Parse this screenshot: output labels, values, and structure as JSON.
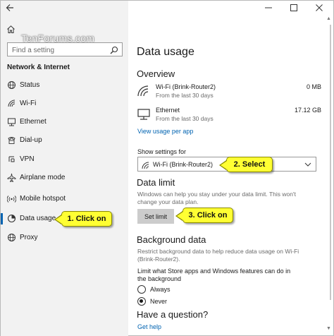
{
  "watermark": "TenForums.com",
  "sidebar": {
    "search_placeholder": "Find a setting",
    "heading": "Network & Internet",
    "items": [
      {
        "label": "Status",
        "icon": "globe-icon"
      },
      {
        "label": "Wi-Fi",
        "icon": "wifi-icon"
      },
      {
        "label": "Ethernet",
        "icon": "ethernet-icon"
      },
      {
        "label": "Dial-up",
        "icon": "dialup-icon"
      },
      {
        "label": "VPN",
        "icon": "vpn-icon"
      },
      {
        "label": "Airplane mode",
        "icon": "airplane-icon"
      },
      {
        "label": "Mobile hotspot",
        "icon": "hotspot-icon"
      },
      {
        "label": "Data usage",
        "icon": "data-usage-icon",
        "selected": true
      },
      {
        "label": "Proxy",
        "icon": "globe-icon"
      }
    ]
  },
  "main": {
    "title": "Data usage",
    "overview": {
      "heading": "Overview",
      "networks": [
        {
          "name": "Wi-Fi (Brink-Router2)",
          "period": "From the last 30 days",
          "value": "0 MB"
        },
        {
          "name": "Ethernet",
          "period": "From the last 30 days",
          "value": "17.12 GB"
        }
      ],
      "link": "View usage per app"
    },
    "show_settings": {
      "label": "Show settings for",
      "selected": "Wi-Fi (Brink-Router2)"
    },
    "data_limit": {
      "heading": "Data limit",
      "desc": "Windows can help you stay under your data limit. This won't change your data plan.",
      "button": "Set limit"
    },
    "background": {
      "heading": "Background data",
      "desc": "Restrict background data to help reduce data usage on Wi-Fi (Brink-Router2).",
      "question": "Limit what Store apps and Windows features can do in the background",
      "options": [
        "Always",
        "Never"
      ],
      "selected": "Never"
    },
    "help": {
      "heading": "Have a question?",
      "link": "Get help"
    }
  },
  "callouts": {
    "one": "1. Click on",
    "two": "2. Select",
    "three": "3. Click on"
  },
  "colors": {
    "accent": "#0063b1",
    "callout": "#ffff33",
    "sidebar_bg": "#f2f2f2"
  }
}
